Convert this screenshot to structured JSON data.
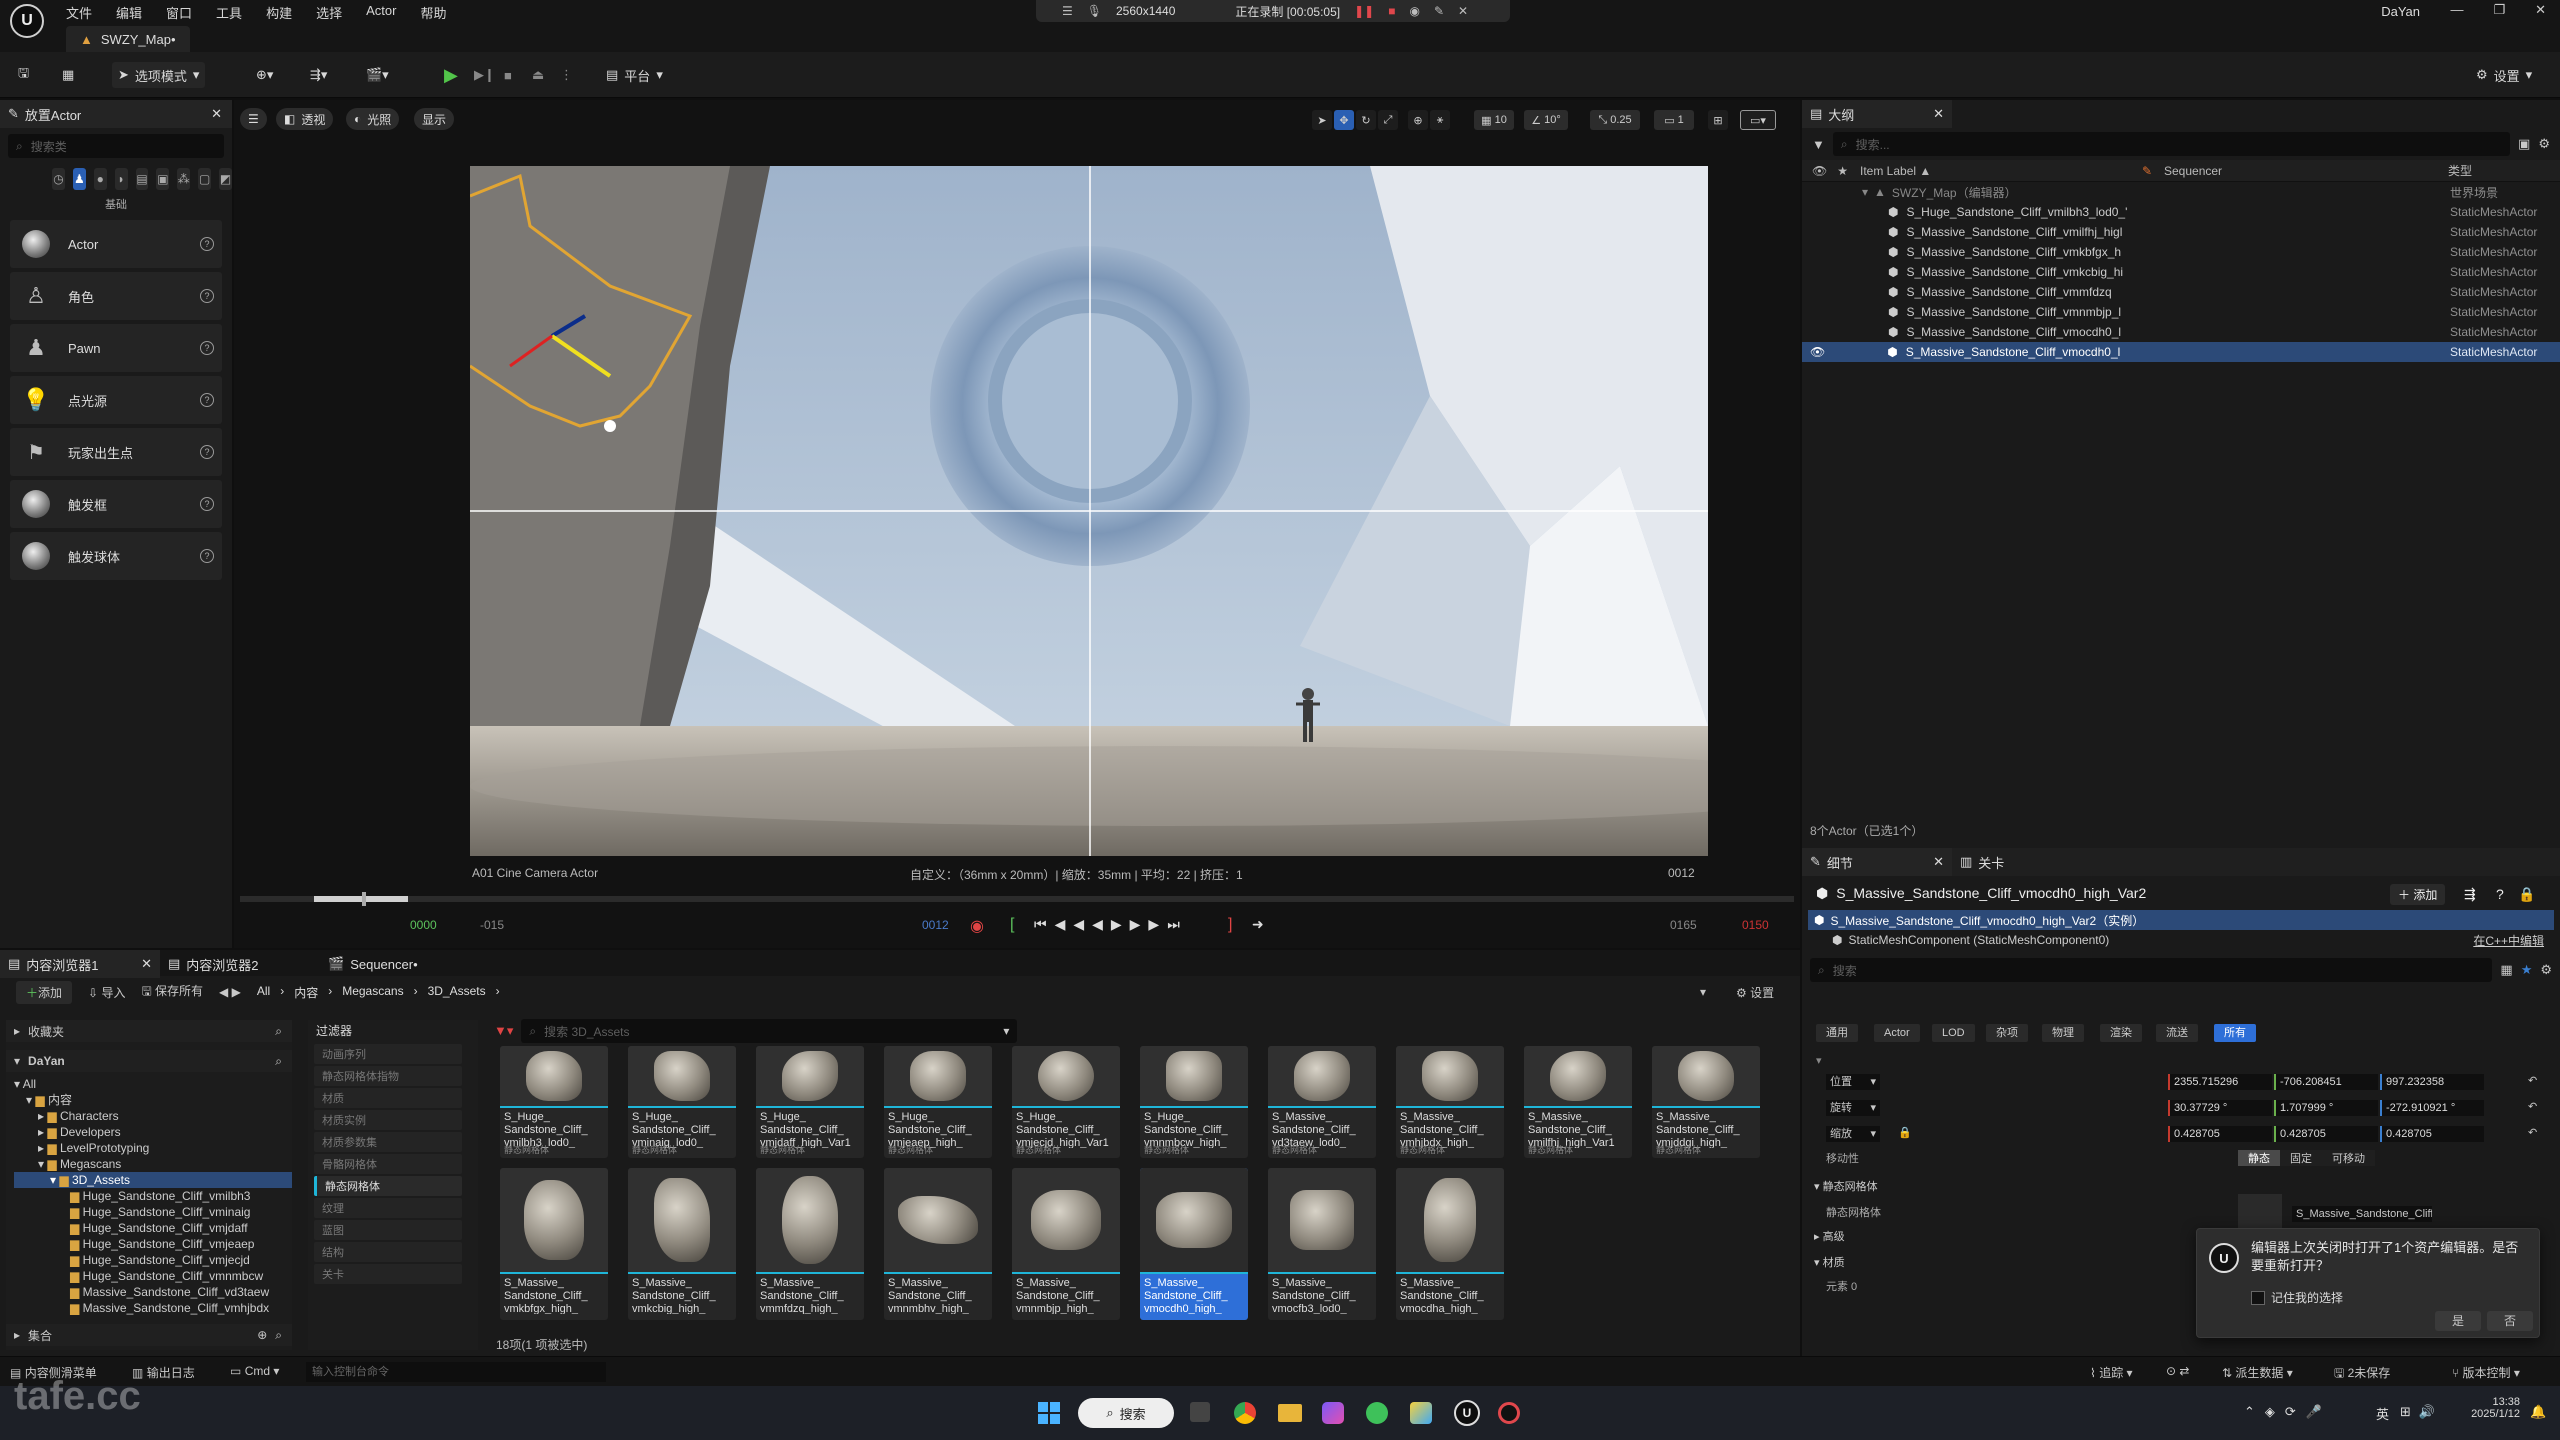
{
  "menubar": {
    "menus": [
      "文件",
      "编辑",
      "窗口",
      "工具",
      "构建",
      "选择",
      "Actor",
      "帮助"
    ],
    "recording": {
      "resolution": "2560x1440",
      "status": "正在录制 [00:05:05]"
    },
    "user": "DaYan"
  },
  "map_tab": {
    "label": "SWZY_Map•"
  },
  "toolbar": {
    "select_mode": "选项模式",
    "platform": "平台",
    "settings": "设置"
  },
  "place_actors": {
    "tab": "放置Actor",
    "search_placeholder": "搜索类",
    "category_label": "基础",
    "items": [
      "Actor",
      "角色",
      "Pawn",
      "点光源",
      "玩家出生点",
      "触发框",
      "触发球体"
    ]
  },
  "viewport": {
    "perspective": "透视",
    "lighting": "光照",
    "show": "显示",
    "grid_snap": "10",
    "rot_snap": "10°",
    "scale_snap": "0.25",
    "cam_speed": "1",
    "camera_name": "A01 Cine Camera Actor",
    "camera_info": "自定义：（36mm x 20mm）| 缩放：35mm | 平均：22 | 挤压：1",
    "frame_label": "0012",
    "tl_start": "0000",
    "tl_neg": "-015",
    "tl_cur": "0012",
    "tl_end_a": "0165",
    "tl_end_b": "0150"
  },
  "outliner": {
    "tab": "大纲",
    "search_placeholder": "搜索...",
    "col_label": "Item Label ▲",
    "col_seq": "Sequencer",
    "col_type": "类型",
    "root": "SWZY_Map（编辑器）",
    "root_type": "世界场景",
    "rows": [
      "S_Huge_Sandstone_Cliff_vmilbh3_lod0_'",
      "S_Massive_Sandstone_Cliff_vmilfhj_higl",
      "S_Massive_Sandstone_Cliff_vmkbfgx_h",
      "S_Massive_Sandstone_Cliff_vmkcbig_hi",
      "S_Massive_Sandstone_Cliff_vmmfdzq",
      "S_Massive_Sandstone_Cliff_vmnmbjp_l",
      "S_Massive_Sandstone_Cliff_vmocdh0_l",
      "S_Massive_Sandstone_Cliff_vmocdh0_l"
    ],
    "row_type": "StaticMeshActor",
    "footer": "8个Actor（已选1个）"
  },
  "details": {
    "tab": "细节",
    "tab2": "关卡",
    "title": "S_Massive_Sandstone_Cliff_vmocdh0_high_Var2",
    "add": "添加",
    "instance": "S_Massive_Sandstone_Cliff_vmocdh0_high_Var2（实例）",
    "component": "StaticMeshComponent (StaticMeshComponent0)",
    "edit_cpp": "在C++中编辑",
    "search_placeholder": "搜索",
    "filters": [
      "通用",
      "Actor",
      "LOD",
      "杂项",
      "物理",
      "渲染",
      "流送",
      "所有"
    ],
    "location_label": "位置",
    "location": [
      "2355.715296",
      "-706.208451",
      "997.232358"
    ],
    "rotation_label": "旋转",
    "rotation": [
      "30.37729 °",
      "1.707999 °",
      "-272.910921 °"
    ],
    "scale_label": "缩放",
    "scale": [
      "0.428705",
      "0.428705",
      "0.428705"
    ],
    "mobility_label": "移动性",
    "mobility": [
      "静态",
      "固定",
      "可移动"
    ],
    "static_mesh_header": "静态网格体",
    "static_mesh_label": "静态网格体",
    "static_mesh_value": "S_Massive_Sandstone_Cliff_vmc",
    "advanced": "高级",
    "materials": "材质",
    "element0": "元素 0"
  },
  "dialog": {
    "text": "编辑器上次关闭时打开了1个资产编辑器。是否要重新打开？",
    "remember": "记住我的选择",
    "yes": "是",
    "no": "否"
  },
  "content": {
    "tab1": "内容浏览器1",
    "tab2": "内容浏览器2",
    "tab3": "Sequencer•",
    "add": "添加",
    "import": "导入",
    "save_all": "保存所有",
    "path": [
      "All",
      "内容",
      "Megascans",
      "3D_Assets"
    ],
    "settings": "设置",
    "favorites": "收藏夹",
    "project": "DaYan",
    "filters_label": "过滤器",
    "filter_items": [
      "动画序列",
      "静态网格体指物",
      "材质",
      "材质实例",
      "材质参数集",
      "骨骼网格体",
      "静态网格体",
      "纹理",
      "蓝图",
      "结构",
      "关卡"
    ],
    "search_placeholder": "搜索 3D_Assets",
    "tree": [
      "All",
      "内容",
      "Characters",
      "Developers",
      "LevelPrototyping",
      "Megascans",
      "3D_Assets",
      "Huge_Sandstone_Cliff_vmilbh3",
      "Huge_Sandstone_Cliff_vminaig",
      "Huge_Sandstone_Cliff_vmjdaff",
      "Huge_Sandstone_Cliff_vmjeaep",
      "Huge_Sandstone_Cliff_vmjecjd",
      "Huge_Sandstone_Cliff_vmnmbcw",
      "Massive_Sandstone_Cliff_vd3taew",
      "Massive_Sandstone_Cliff_vmhjbdx"
    ],
    "collections": "集合",
    "assets_row1": [
      "S_Huge_ Sandstone_Cliff_ vmilbh3_lod0_",
      "S_Huge_ Sandstone_Cliff_ vminaig_lod0_",
      "S_Huge_ Sandstone_Cliff_ vmjdaff_high_Var1",
      "S_Huge_ Sandstone_Cliff_ vmjeaep_high_",
      "S_Huge_ Sandstone_Cliff_ vmjecjd_high_Var1",
      "S_Huge_ Sandstone_Cliff_ vmnmbcw_high_",
      "S_Massive_ Sandstone_Cliff_ vd3taew_lod0_",
      "S_Massive_ Sandstone_Cliff_ vmhjbdx_high_",
      "S_Massive_ Sandstone_Cliff_ vmilfhj_high_Var1",
      "S_Massive_ Sandstone_Cliff_ vmjddgi_high_"
    ],
    "assets_row2": [
      "S_Massive_ Sandstone_Cliff_ vmkbfgx_high_",
      "S_Massive_ Sandstone_Cliff_ vmkcbig_high_",
      "S_Massive_ Sandstone_Cliff_ vmmfdzq_high_",
      "S_Massive_ Sandstone_Cliff_ vmnmbhv_high_",
      "S_Massive_ Sandstone_Cliff_ vmnmbjp_high_",
      "S_Massive_ Sandstone_Cliff_ vmocdh0_high_",
      "S_Massive_ Sandstone_Cliff_ vmocfb3_lod0_",
      "S_Massive_ Sandstone_Cliff_ vmocdha_high_"
    ],
    "asset_kind": "静态网格体",
    "count": "18项(1 项被选中)"
  },
  "statusbar": {
    "drawer": "内容侧滑菜单",
    "log": "输出日志",
    "cmd": "Cmd",
    "console_placeholder": "输入控制台命令",
    "trace": "追踪",
    "derived": "派生数据",
    "unsaved": "2未保存",
    "source": "版本控制"
  },
  "taskbar": {
    "search": "搜索",
    "time": "13:38",
    "date": "2025/1/12",
    "ime": "英"
  },
  "watermark": "tafe.cc"
}
